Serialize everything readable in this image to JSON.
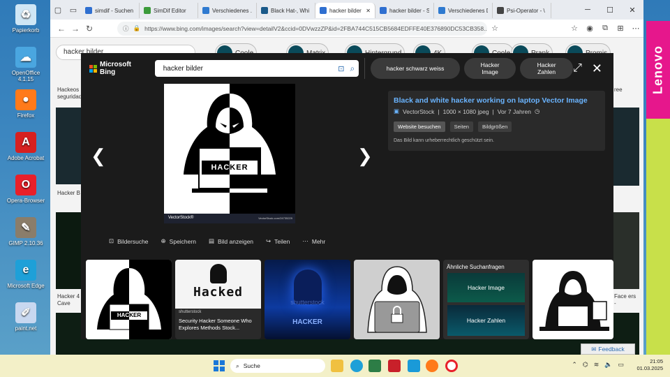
{
  "desktop": {
    "icons": [
      {
        "label": "Papierkorb",
        "icon": "recycle-bin-icon",
        "color": "#cfe6f5",
        "glyph": "♻"
      },
      {
        "label": "OpenOffice 4.1.15",
        "icon": "openoffice-icon",
        "color": "#4aa6e0",
        "glyph": "☁"
      },
      {
        "label": "Firefox",
        "icon": "firefox-icon",
        "color": "#ff7a1a",
        "glyph": "●"
      },
      {
        "label": "Adobe Acrobat",
        "icon": "acrobat-icon",
        "color": "#d62020",
        "glyph": "A"
      },
      {
        "label": "Opera-Browser",
        "icon": "opera-icon",
        "color": "#e8202a",
        "glyph": "O"
      },
      {
        "label": "GIMP 2.10.36",
        "icon": "gimp-icon",
        "color": "#8a7d6a",
        "glyph": "✎"
      },
      {
        "label": "Microsoft Edge",
        "icon": "edge-icon",
        "color": "#1ea0d8",
        "glyph": "e"
      },
      {
        "label": "paint.net",
        "icon": "paintnet-icon",
        "color": "#c8d8f0",
        "glyph": "✐"
      }
    ],
    "oem_logo": "Lenovo"
  },
  "browser": {
    "tabs": [
      {
        "label": "simdif - Suchen",
        "color": "#2f6fd0"
      },
      {
        "label": "SimDif Editor",
        "color": "#3b9b3b"
      },
      {
        "label": "Verschiedenes .",
        "color": "#2f7ad0"
      },
      {
        "label": "Black Hat-, Whi",
        "color": "#1a5a8a"
      },
      {
        "label": "hacker bilder",
        "color": "#2f6fd0",
        "active": true
      },
      {
        "label": "hacker bilder - S",
        "color": "#2f6fd0"
      },
      {
        "label": "Verschiedenes D",
        "color": "#2f7ad0"
      },
      {
        "label": "Psi-Operator - \\",
        "color": "#444"
      }
    ],
    "url": "https://www.bing.com/images/search?view=detailV2&ccid=0DVwzzZP&id=2FBA744C515CB5684EDFFE40E376890DC53CB358..."
  },
  "background": {
    "search_value": "hacker bilder",
    "chips": [
      "Coole",
      "Matrix",
      "Hintergrund",
      "4K",
      "Coole",
      "Prank",
      "Promis"
    ],
    "captions": [
      "Hackeos seguridad",
      "Hacker B",
      "Hacker 4 Cave",
      "ree",
      "Face ers -"
    ]
  },
  "viewer": {
    "brand": "Microsoft Bing",
    "search_value": "hacker bilder",
    "suggestions": [
      "hacker schwarz weiss",
      "Hacker Image",
      "Hacker Zahlen"
    ],
    "image_text": "HACKER",
    "image_watermark": "VectorStock®",
    "image_credit": "VectorStock.com/24735229",
    "title": "Black and white hacker working on laptop Vector Image",
    "source": "VectorStock",
    "dimensions": "1000 × 1080 jpeg",
    "age": "Vor 7 Jahren",
    "buttons": [
      "Website besuchen",
      "Seiten",
      "Bildgrößen"
    ],
    "copyright": "Das Bild kann urheberrechtlich geschützt sein.",
    "actions": [
      "Bildersuche",
      "Speichern",
      "Bild anzeigen",
      "Teilen",
      "Mehr"
    ],
    "related": {
      "tile2_title": "Hacked",
      "tile2_source": "shutterstock",
      "tile2_caption": "Security Hacker Someone Who Explores Methods Stock...",
      "tile3_watermark": "shutterstock",
      "tile3_text": "HACKER",
      "tile5_heading": "Ähnliche Suchanfragen",
      "tile5_items": [
        "Hacker Image",
        "Hacker Zahlen"
      ]
    },
    "feedback": "Feedback"
  },
  "taskbar": {
    "search": "Suche",
    "time": "21:05",
    "date": "01.03.2025"
  }
}
